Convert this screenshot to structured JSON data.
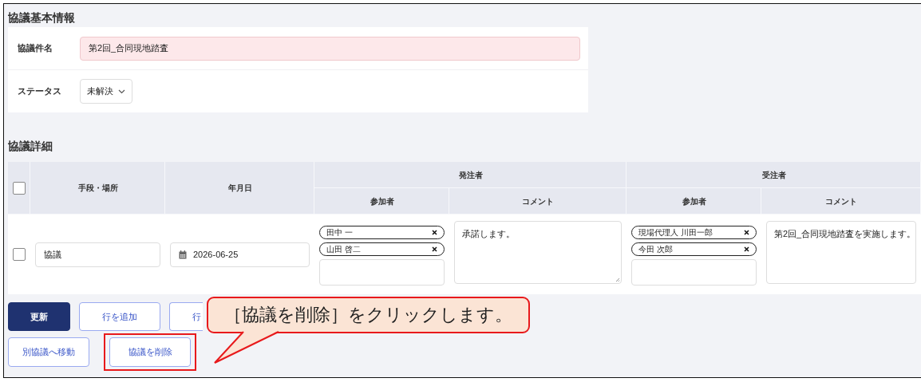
{
  "basic_info": {
    "title": "協議基本情報",
    "fields": [
      {
        "kind": "text",
        "label": "協議件名",
        "value": "第2回_合同現地踏査",
        "invalid": true
      },
      {
        "kind": "select",
        "label": "ステータス",
        "value": "未解決"
      }
    ]
  },
  "details": {
    "title": "協議詳細",
    "header_checked": false,
    "columns": [
      "手段・場所",
      "年月日"
    ],
    "groups": [
      {
        "label": "発注者",
        "columns": [
          "参加者",
          "コメント"
        ]
      },
      {
        "label": "受注者",
        "columns": [
          "参加者",
          "コメント"
        ]
      }
    ],
    "rows": [
      {
        "checked": false,
        "method": "協議",
        "date": "2026-06-25",
        "orderer_participants": [
          "田中 一",
          "山田 啓二"
        ],
        "orderer_comment": "承諾します。",
        "contractor_participants": [
          "現場代理人 川田一郎",
          "今田 次郎"
        ],
        "contractor_comment": "第2回_合同現地踏査を実施します。"
      }
    ]
  },
  "button_rows": [
    [
      {
        "label": "更新",
        "kind": "primary",
        "highlighted": false
      },
      {
        "label": "行を追加",
        "kind": "outline",
        "highlighted": false
      },
      {
        "label": "行",
        "kind": "outline",
        "highlighted": false
      }
    ],
    [
      {
        "label": "別協議へ移動",
        "kind": "outline",
        "highlighted": false
      },
      {
        "label": "協議を削除",
        "kind": "outline",
        "highlighted": true
      }
    ]
  ],
  "callout": {
    "text": "［協議を削除］をクリックします。"
  }
}
